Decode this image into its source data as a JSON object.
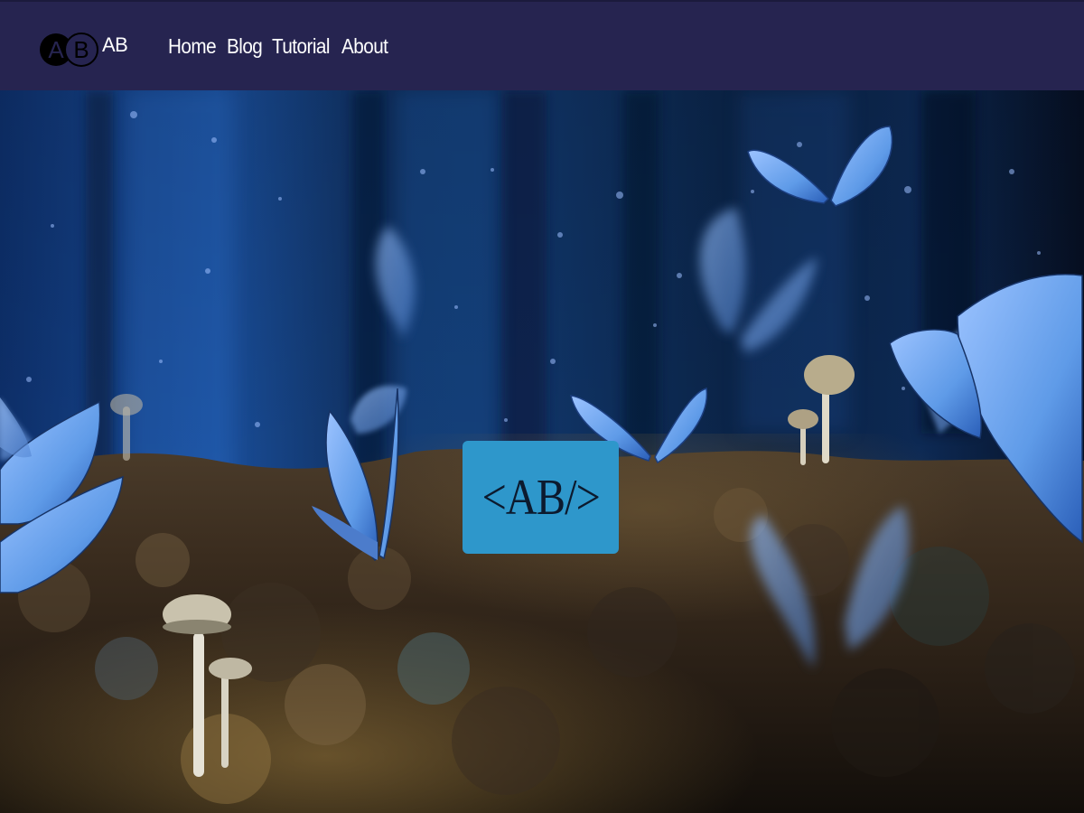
{
  "header": {
    "logo_letters": "AB",
    "brand": "AB",
    "nav": [
      {
        "label": "Home"
      },
      {
        "label": "Blog"
      },
      {
        "label": "Tutorial"
      },
      {
        "label": "About"
      }
    ]
  },
  "hero": {
    "badge_text": "<AB/>"
  },
  "colors": {
    "navbar": "#262450",
    "badge": "#2e97cb",
    "butterfly": "#5f9be8"
  }
}
